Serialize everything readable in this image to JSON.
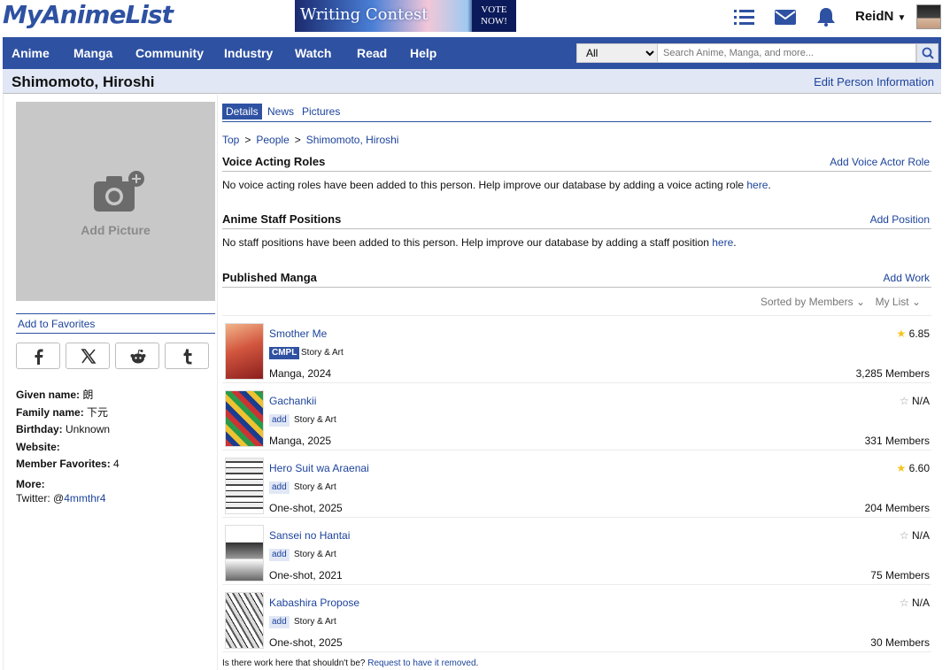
{
  "header": {
    "logo": "MyAnimeList",
    "banner": {
      "title": "Writing Contest",
      "vote": "VOTE NOW!"
    },
    "username": "ReidN",
    "icons": [
      "list-icon",
      "mail-icon",
      "bell-icon",
      "chevron-down-icon"
    ]
  },
  "nav": {
    "items": [
      "Anime",
      "Manga",
      "Community",
      "Industry",
      "Watch",
      "Read",
      "Help"
    ],
    "search_category": "All",
    "search_placeholder": "Search Anime, Manga, and more..."
  },
  "page": {
    "title": "Shimomoto, Hiroshi",
    "edit_link": "Edit Person Information"
  },
  "left": {
    "add_picture": "Add Picture",
    "add_favorites": "Add to Favorites",
    "share_icons": [
      "facebook-icon",
      "x-icon",
      "reddit-icon",
      "tumblr-icon"
    ],
    "info": [
      {
        "label": "Given name:",
        "value": "朗"
      },
      {
        "label": "Family name:",
        "value": "下元"
      },
      {
        "label": "Birthday:",
        "value": "Unknown"
      },
      {
        "label": "Website:",
        "value": ""
      },
      {
        "label": "Member Favorites:",
        "value": "4"
      }
    ],
    "more_label": "More:",
    "twitter_prefix": "Twitter: @",
    "twitter_handle": "4mmthr4"
  },
  "tabs": [
    "Details",
    "News",
    "Pictures"
  ],
  "breadcrumb": [
    "Top",
    "People",
    "Shimomoto, Hiroshi"
  ],
  "voice": {
    "heading": "Voice Acting Roles",
    "action": "Add Voice Actor Role",
    "message": "No voice acting roles have been added to this person. Help improve our database by adding a voice acting role ",
    "link": "here",
    "end": "."
  },
  "staff": {
    "heading": "Anime Staff Positions",
    "action": "Add Position",
    "message": "No staff positions have been added to this person. Help improve our database by adding a staff position ",
    "link": "here",
    "end": "."
  },
  "manga": {
    "heading": "Published Manga",
    "action": "Add Work",
    "sort": "Sorted by Members",
    "mylist": "My List",
    "items": [
      {
        "title": "Smother Me",
        "tag": "CMPL",
        "role": "Story & Art",
        "type": "Manga, 2024",
        "score": "6.85",
        "members": "3,285 Members",
        "scored": true
      },
      {
        "title": "Gachankii",
        "tag": "add",
        "role": "Story & Art",
        "type": "Manga, 2025",
        "score": "N/A",
        "members": "331 Members",
        "scored": false
      },
      {
        "title": "Hero Suit wa Araenai",
        "tag": "add",
        "role": "Story & Art",
        "type": "One-shot, 2025",
        "score": "6.60",
        "members": "204 Members",
        "scored": true
      },
      {
        "title": "Sansei no Hantai",
        "tag": "add",
        "role": "Story & Art",
        "type": "One-shot, 2021",
        "score": "N/A",
        "members": "75 Members",
        "scored": false
      },
      {
        "title": "Kabashira Propose",
        "tag": "add",
        "role": "Story & Art",
        "type": "One-shot, 2025",
        "score": "N/A",
        "members": "30 Members",
        "scored": false
      }
    ],
    "footnote": "Is there work here that shouldn't be? ",
    "footnote_link": "Request to have it removed",
    "footnote_end": "."
  },
  "colors": {
    "brand": "#2e51a2",
    "link": "#1c439b",
    "star": "#f5c518",
    "light": "#e1e7f5"
  }
}
